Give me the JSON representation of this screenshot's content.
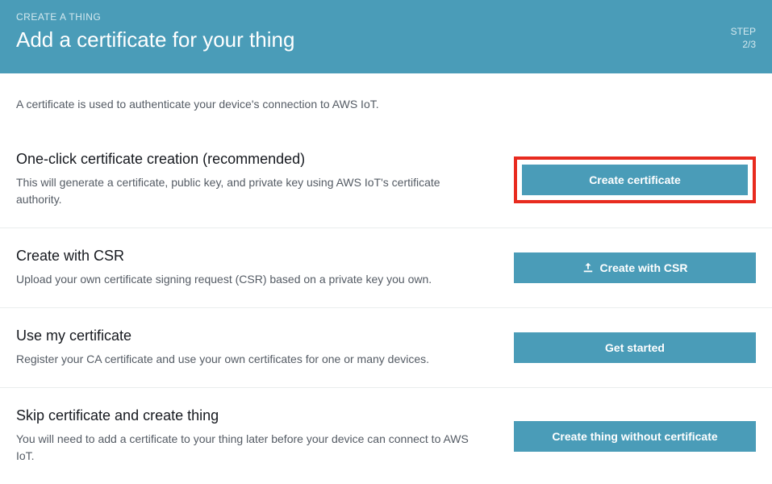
{
  "header": {
    "breadcrumb": "CREATE A THING",
    "title": "Add a certificate for your thing",
    "step_label": "STEP",
    "step_value": "2/3"
  },
  "intro": "A certificate is used to authenticate your device's connection to AWS IoT.",
  "options": [
    {
      "title": "One-click certificate creation (recommended)",
      "desc": "This will generate a certificate, public key, and private key using AWS IoT's certificate authority.",
      "button": "Create certificate"
    },
    {
      "title": "Create with CSR",
      "desc": "Upload your own certificate signing request (CSR) based on a private key you own.",
      "button": "Create with CSR"
    },
    {
      "title": "Use my certificate",
      "desc": "Register your CA certificate and use your own certificates for one or many devices.",
      "button": "Get started"
    },
    {
      "title": "Skip certificate and create thing",
      "desc": "You will need to add a certificate to your thing later before your device can connect to AWS IoT.",
      "button": "Create thing without certificate"
    }
  ]
}
